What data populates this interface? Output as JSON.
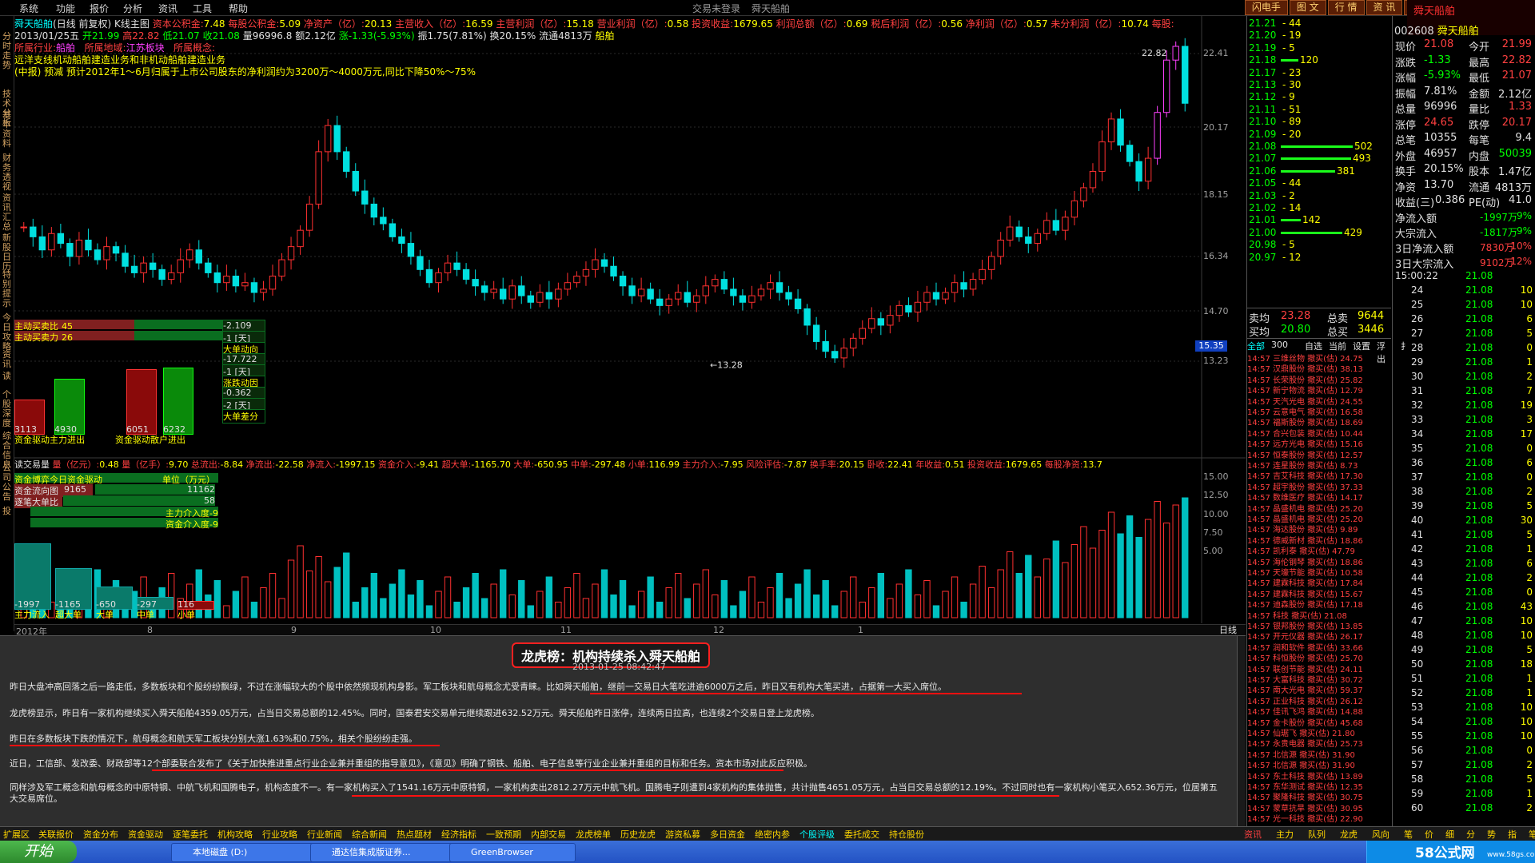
{
  "menu": {
    "items": [
      "系统",
      "功能",
      "报价",
      "分析",
      "资讯",
      "工具",
      "帮助"
    ],
    "center": [
      "交易未登录",
      "舜天船舶"
    ],
    "right_tabs": [
      "闪电手",
      "图 文",
      "行 情",
      "资 讯",
      "深 度",
      "交 易"
    ],
    "brand": "舜天船舶"
  },
  "vtabs": [
    "分时走势",
    "技术分析",
    "基本资料",
    "财务透视",
    "资讯汇总",
    "新股日历",
    "特别提示",
    "今日攻略",
    "资讯",
    "读",
    "个股深度",
    "综合信息",
    "公司公告",
    "投"
  ],
  "header": {
    "line1": {
      "name": "舜天船舶",
      "period": "(日线 前复权) K线主图",
      "items": [
        [
          "资本公积金:",
          "7.48"
        ],
        [
          "每股公积金:",
          "5.09"
        ],
        [
          "净资产（亿）:",
          "20.13"
        ],
        [
          "主营收入（亿）:",
          "16.59"
        ],
        [
          "主营利润（亿）:",
          "15.18"
        ],
        [
          "营业利润（亿）:",
          "0.58"
        ],
        [
          "投资收益:",
          "1679.65"
        ],
        [
          "利润总额（亿）:",
          "0.69"
        ],
        [
          "税后利润（亿）:",
          "0.56"
        ],
        [
          "净利润（亿）:",
          "0.57"
        ],
        [
          "未分利润（亿）:",
          "10.74"
        ],
        [
          "每股:",
          ""
        ]
      ]
    },
    "line2": {
      "date": "2013/01/25五",
      "open": "开21.99",
      "high": "高22.82",
      "low": "低21.07",
      "close": "收21.08",
      "vol": "量96996.8",
      "amt": "额2.12亿",
      "chg": "涨-1.33(-5.93%)",
      "amp": "振1.75(7.81%)",
      "turn": "换20.15%",
      "float": "流通4813万",
      "tag": "船舶"
    },
    "line3": {
      "industry_label": "所属行业:",
      "industry": "船舶",
      "region_label": "所属地域:",
      "region": "江苏板块",
      "concept_label": "所属概念:"
    },
    "line4": "远洋支线机动船舶建造业务和非机动船舶建造业务",
    "line5": "(中报) 预减 预计2012年1～6月归属于上市公司股东的净利润约为3200万～4000万元,同比下降50%～75%"
  },
  "price_axis": [
    "22.41",
    "20.17",
    "18.15",
    "16.34",
    "14.70",
    "13.23"
  ],
  "price_marks": {
    "high": "22.82",
    "low": "13.28",
    "last_box": "15.35"
  },
  "gauges": {
    "buy_ratio_label": "主动买卖比",
    "buy_ratio_l": "45",
    "buy_ratio_r": "55",
    "buy_power_label": "主动买卖力",
    "buy_power_l": "26",
    "buy_power_r": "36",
    "values": [
      "-2.109",
      "-1 [天]",
      "大单动向",
      "-17.722",
      "-1 [天]",
      "涨跌动因",
      "-0.362",
      "-2 [天]",
      "大单差分"
    ],
    "bars": [
      {
        "label": "3113",
        "h": 0.42
      },
      {
        "label": "4930",
        "h": 0.68
      },
      {
        "label": "6051",
        "h": 0.8
      },
      {
        "label": "6232",
        "h": 0.82
      }
    ],
    "foot": [
      "资金驱动主力进出",
      "资金驱动散户进出"
    ]
  },
  "vol_header": {
    "items": [
      [
        "读交易量",
        ""
      ],
      [
        "量（亿元）:",
        "0.48"
      ],
      [
        "量（亿手）:",
        "9.70"
      ],
      [
        "总流出:",
        "-8.84"
      ],
      [
        "净流出:",
        "-22.58"
      ],
      [
        "净流入:",
        "-1997.15"
      ],
      [
        "资金介入:",
        "-9.41"
      ],
      [
        "超大单:",
        "-1165.70"
      ],
      [
        "大单:",
        "-650.95"
      ],
      [
        "中单:",
        "-297.48"
      ],
      [
        "小单:",
        "116.99"
      ],
      [
        "主力介入:",
        "-7.95"
      ],
      [
        "风险评估:",
        "-7.87"
      ],
      [
        "换手率:",
        "20.15"
      ],
      [
        "卧收:",
        "22.41"
      ],
      [
        "年收益:",
        "0.51"
      ],
      [
        "投资收益:",
        "1679.65"
      ],
      [
        "每股净资:",
        "13.7"
      ]
    ]
  },
  "vol_axis": [
    "15.00",
    "12.50",
    "10.00",
    "7.50",
    "5.00"
  ],
  "fund_box": {
    "title": "资金博弈今日资金驱动",
    "unit": "单位（万元）",
    "rows": [
      [
        "资金流向图",
        "9165",
        "11162"
      ],
      [
        "逐笔大单比",
        "41",
        "58"
      ]
    ],
    "lines": [
      "主力介入度-9",
      "资金介入度-9"
    ],
    "bars": [
      {
        "v": "-1997",
        "l": "主力流入",
        "h": 0.9
      },
      {
        "v": "-1165",
        "l": "超大单",
        "h": 0.55
      },
      {
        "v": "-650",
        "l": "大单",
        "h": 0.3
      },
      {
        "v": "-297",
        "l": "中单",
        "h": 0.15
      },
      {
        "v": "116",
        "l": "小单",
        "h": 0.1
      }
    ]
  },
  "time_axis": [
    "2012年",
    "8",
    "9",
    "10",
    "11",
    "12",
    "1"
  ],
  "daily_label": "日线",
  "ladder": [
    [
      "21.21",
      "44"
    ],
    [
      "21.20",
      "19"
    ],
    [
      "21.19",
      "5"
    ],
    [
      "21.18",
      "120"
    ],
    [
      "21.17",
      "23"
    ],
    [
      "21.13",
      "30"
    ],
    [
      "21.12",
      "9"
    ],
    [
      "21.11",
      "51"
    ],
    [
      "21.10",
      "89"
    ],
    [
      "21.09",
      "20"
    ],
    [
      "21.08",
      "502"
    ],
    [
      "21.07",
      "493"
    ],
    [
      "21.06",
      "381"
    ],
    [
      "21.05",
      "44"
    ],
    [
      "21.03",
      "2"
    ],
    [
      "21.02",
      "14"
    ],
    [
      "21.01",
      "142"
    ],
    [
      "21.00",
      "429"
    ],
    [
      "20.98",
      "5"
    ],
    [
      "20.97",
      "12"
    ]
  ],
  "avg": {
    "sell_label": "卖均",
    "sell": "23.28",
    "sell_total_label": "总卖",
    "sell_total": "9644",
    "buy_label": "买均",
    "buy": "20.80",
    "buy_total_label": "总买",
    "buy_total": "3446"
  },
  "list_tabs": [
    "全部",
    "300",
    "自选",
    "当前",
    "设置",
    "浮出",
    "扌"
  ],
  "list": [
    [
      "14:57",
      "三维丝物",
      "撤买(估)",
      "24.75"
    ],
    [
      "14:57",
      "汉鼎股份",
      "撤买(估)",
      "38.13"
    ],
    [
      "14:57",
      "长荣股份",
      "撤买(估)",
      "25.82"
    ],
    [
      "14:57",
      "新宁物流",
      "撤买(估)",
      "12.79"
    ],
    [
      "14:57",
      "天汽光电",
      "撤买(估)",
      "24.55"
    ],
    [
      "14:57",
      "云意电气",
      "撤买(估)",
      "16.58"
    ],
    [
      "14:57",
      "福斯股份",
      "撤买(估)",
      "18.69"
    ],
    [
      "14:57",
      "合兴包装",
      "撤买(估)",
      "10.44"
    ],
    [
      "14:57",
      "远方光电",
      "撤买(估)",
      "15.16"
    ],
    [
      "14:57",
      "恒泰股份",
      "撤买(估)",
      "12.57"
    ],
    [
      "14:57",
      "连星股份",
      "撤买(估)",
      "8.73"
    ],
    [
      "14:57",
      "吉艾科技",
      "撤买(估)",
      "17.30"
    ],
    [
      "14:57",
      "超宇股份",
      "撤买(估)",
      "37.33"
    ],
    [
      "14:57",
      "数维医疗",
      "撤买(估)",
      "14.17"
    ],
    [
      "14:57",
      "晶盛机电",
      "撤买(估)",
      "25.20"
    ],
    [
      "14:57",
      "晶盛机电",
      "撤买(估)",
      "25.20"
    ],
    [
      "14:57",
      "海达股份",
      "撤买(估)",
      "9.89"
    ],
    [
      "14:57",
      "德威新材",
      "撤买(估)",
      "18.86"
    ],
    [
      "14:57",
      "凯利泰",
      "撤买(估)",
      "47.79"
    ],
    [
      "14:57",
      "海伦钢琴",
      "撤买(估)",
      "18.86"
    ],
    [
      "14:57",
      "天壕节能",
      "撤买(估)",
      "10.58"
    ],
    [
      "14:57",
      "建霖科技",
      "撤买(估)",
      "17.84"
    ],
    [
      "14:57",
      "建霖科技",
      "撤买(估)",
      "15.67"
    ],
    [
      "14:57",
      "迪森股份",
      "撤买(估)",
      "17.18"
    ],
    [
      "14:57",
      "科技",
      "撤买(估)",
      "21.08"
    ],
    [
      "14:57",
      "银邦股份",
      "撤买(估)",
      "13.85"
    ],
    [
      "14:57",
      "开元仪器",
      "撤买(估)",
      "26.17"
    ],
    [
      "14:57",
      "润和软件",
      "撤买(估)",
      "33.66"
    ],
    [
      "14:57",
      "科恒股份",
      "撤买(估)",
      "25.70"
    ],
    [
      "14:57",
      "联创节能",
      "撤买(估)",
      "24.11"
    ],
    [
      "14:57",
      "大富科技",
      "撤买(估)",
      "30.72"
    ],
    [
      "14:57",
      "南大光电",
      "撤买(估)",
      "59.37"
    ],
    [
      "14:57",
      "正业科技",
      "撤买(估)",
      "26.12"
    ],
    [
      "14:57",
      "佳讯飞鸿",
      "撤买(估)",
      "14.88"
    ],
    [
      "14:57",
      "金卡股份",
      "撤买(估)",
      "45.68"
    ],
    [
      "14:57",
      "仙琚飞",
      "撤买(估)",
      "21.80"
    ],
    [
      "14:57",
      "永贵电器",
      "撤买(估)",
      "25.73"
    ],
    [
      "14:57",
      "北信源",
      "撤买(估)",
      "31.90"
    ],
    [
      "14:57",
      "北信源",
      "撤买(估)",
      "31.90"
    ],
    [
      "14:57",
      "东土科技",
      "撤买(估)",
      "13.89"
    ],
    [
      "14:57",
      "东华测试",
      "撤买(估)",
      "12.35"
    ],
    [
      "14:57",
      "聚隆科技",
      "撤买(估)",
      "30.75"
    ],
    [
      "14:57",
      "蒙草抗旱",
      "撤买(估)",
      "30.95"
    ],
    [
      "14:57",
      "光一科技",
      "撤买(估)",
      "22.90"
    ]
  ],
  "stats": {
    "code": "002608",
    "name": "舜天船舶",
    "rows": [
      [
        "现价",
        "21.08",
        "今开",
        "21.99"
      ],
      [
        "涨跌",
        "-1.33",
        "最高",
        "22.82"
      ],
      [
        "涨幅",
        "-5.93%",
        "最低",
        "21.07"
      ],
      [
        "振幅",
        "7.81%",
        "金额",
        "2.12亿"
      ],
      [
        "总量",
        "96996",
        "量比",
        "1.33"
      ],
      [
        "涨停",
        "24.65",
        "跌停",
        "20.17"
      ],
      [
        "总笔",
        "10355",
        "每笔",
        "9.4"
      ],
      [
        "外盘",
        "46957",
        "内盘",
        "50039"
      ],
      [
        "换手",
        "20.15%",
        "股本",
        "1.47亿"
      ],
      [
        "净资",
        "13.70",
        "流通",
        "4813万"
      ],
      [
        "收益(三)",
        "0.386",
        "PE(动)",
        "41.0"
      ]
    ],
    "flows": [
      [
        "净流入额",
        "-1997万",
        "-9%"
      ],
      [
        "大宗流入",
        "-1817万",
        "-9%"
      ],
      [
        "3日净流入额",
        "7830万",
        "10%"
      ],
      [
        "3日大宗流入",
        "9102万",
        "12%"
      ]
    ]
  },
  "ticks": {
    "time": "15:00:22",
    "price": "21.08",
    "rows": [
      [
        "24",
        "10"
      ],
      [
        "25",
        "10"
      ],
      [
        "26",
        "6"
      ],
      [
        "27",
        "5"
      ],
      [
        "28",
        "0"
      ],
      [
        "29",
        "1"
      ],
      [
        "30",
        "2"
      ],
      [
        "31",
        "7"
      ],
      [
        "32",
        "19"
      ],
      [
        "33",
        "3"
      ],
      [
        "34",
        "17"
      ],
      [
        "35",
        "0"
      ],
      [
        "36",
        "6"
      ],
      [
        "37",
        "0"
      ],
      [
        "38",
        "2"
      ],
      [
        "39",
        "5"
      ],
      [
        "40",
        "30"
      ],
      [
        "41",
        "5"
      ],
      [
        "42",
        "1"
      ],
      [
        "43",
        "6"
      ],
      [
        "44",
        "2"
      ],
      [
        "45",
        "0"
      ],
      [
        "46",
        "43"
      ],
      [
        "47",
        "10"
      ],
      [
        "48",
        "10"
      ],
      [
        "49",
        "5"
      ],
      [
        "50",
        "18"
      ],
      [
        "51",
        "1"
      ],
      [
        "52",
        "1"
      ],
      [
        "53",
        "10"
      ],
      [
        "54",
        "10"
      ],
      [
        "55",
        "10"
      ],
      [
        "56",
        "0"
      ],
      [
        "57",
        "2"
      ],
      [
        "58",
        "5"
      ],
      [
        "59",
        "1"
      ],
      [
        "60",
        "2"
      ]
    ]
  },
  "news": {
    "title": "龙虎榜：机构持续杀入舜天船舶",
    "date": "2013-01-25 08:42:47",
    "paras": [
      "昨日大盘冲高回落之后一路走低，多数板块和个股纷纷飘绿，不过在涨幅较大的个股中依然频现机构身影。军工板块和航母概念尤受青睐。比如舜天船舶，继前一交易日大笔吃进逾6000万之后，昨日又有机构大笔买进，占据第一大买入席位。",
      "龙虎榜显示，昨日有一家机构继续买入舜天船舶4359.05万元，占当日交易总额的12.45%。同时，国泰君安交易单元继续跟进632.52万元。舜天船舶昨日涨停，连续两日拉高，也连续2个交易日登上龙虎榜。",
      "昨日在多数板块下跌的情况下，航母概念和航天军工板块分别大涨1.63%和0.75%，相关个股纷纷走强。",
      "近日，工信部、发改委、财政部等12个部委联合发布了《关于加快推进重点行业企业兼并重组的指导意见》，《意见》明确了钢铁、船舶、电子信息等行业企业兼并重组的目标和任务。资本市场对此反应积极。",
      "同样涉及军工概念和航母概念的中原特钢、中航飞机和国腾电子，机构态度不一。有一家机构买入了1541.16万元中原特钢，一家机构卖出2812.27万元中航飞机。国腾电子则遭到4家机构的集体抛售，共计抛售4651.05万元，占当日交易总额的12.19%。不过同时也有一家机构小笔买入652.36万元，位居第五大交易席位。"
    ]
  },
  "bottom_tabs": [
    "扩展区",
    "关联报价",
    "资金分布",
    "资金驱动",
    "逐笔委托",
    "机构攻略",
    "行业攻略",
    "行业新闻",
    "综合新闻",
    "热点题材",
    "经济指标",
    "一致预期",
    "内部交易",
    "龙虎榜单",
    "历史龙虎",
    "游资私募",
    "多日资金",
    "绝密内参",
    "个股评级",
    "委托成交",
    "持仓股份"
  ],
  "bottom_right": [
    "资讯",
    "主力",
    "队列",
    "龙虎",
    "风向",
    "笔",
    "价",
    "细",
    "分",
    "势",
    "指",
    "笔",
    "价",
    "细"
  ],
  "taskbar": {
    "start": "开始",
    "tasks": [
      "本地磁盘 (D:)",
      "通达信集成版证券...",
      "GreenBrowser"
    ],
    "brand": "58公式网",
    "url": "www.58gs.com"
  }
}
